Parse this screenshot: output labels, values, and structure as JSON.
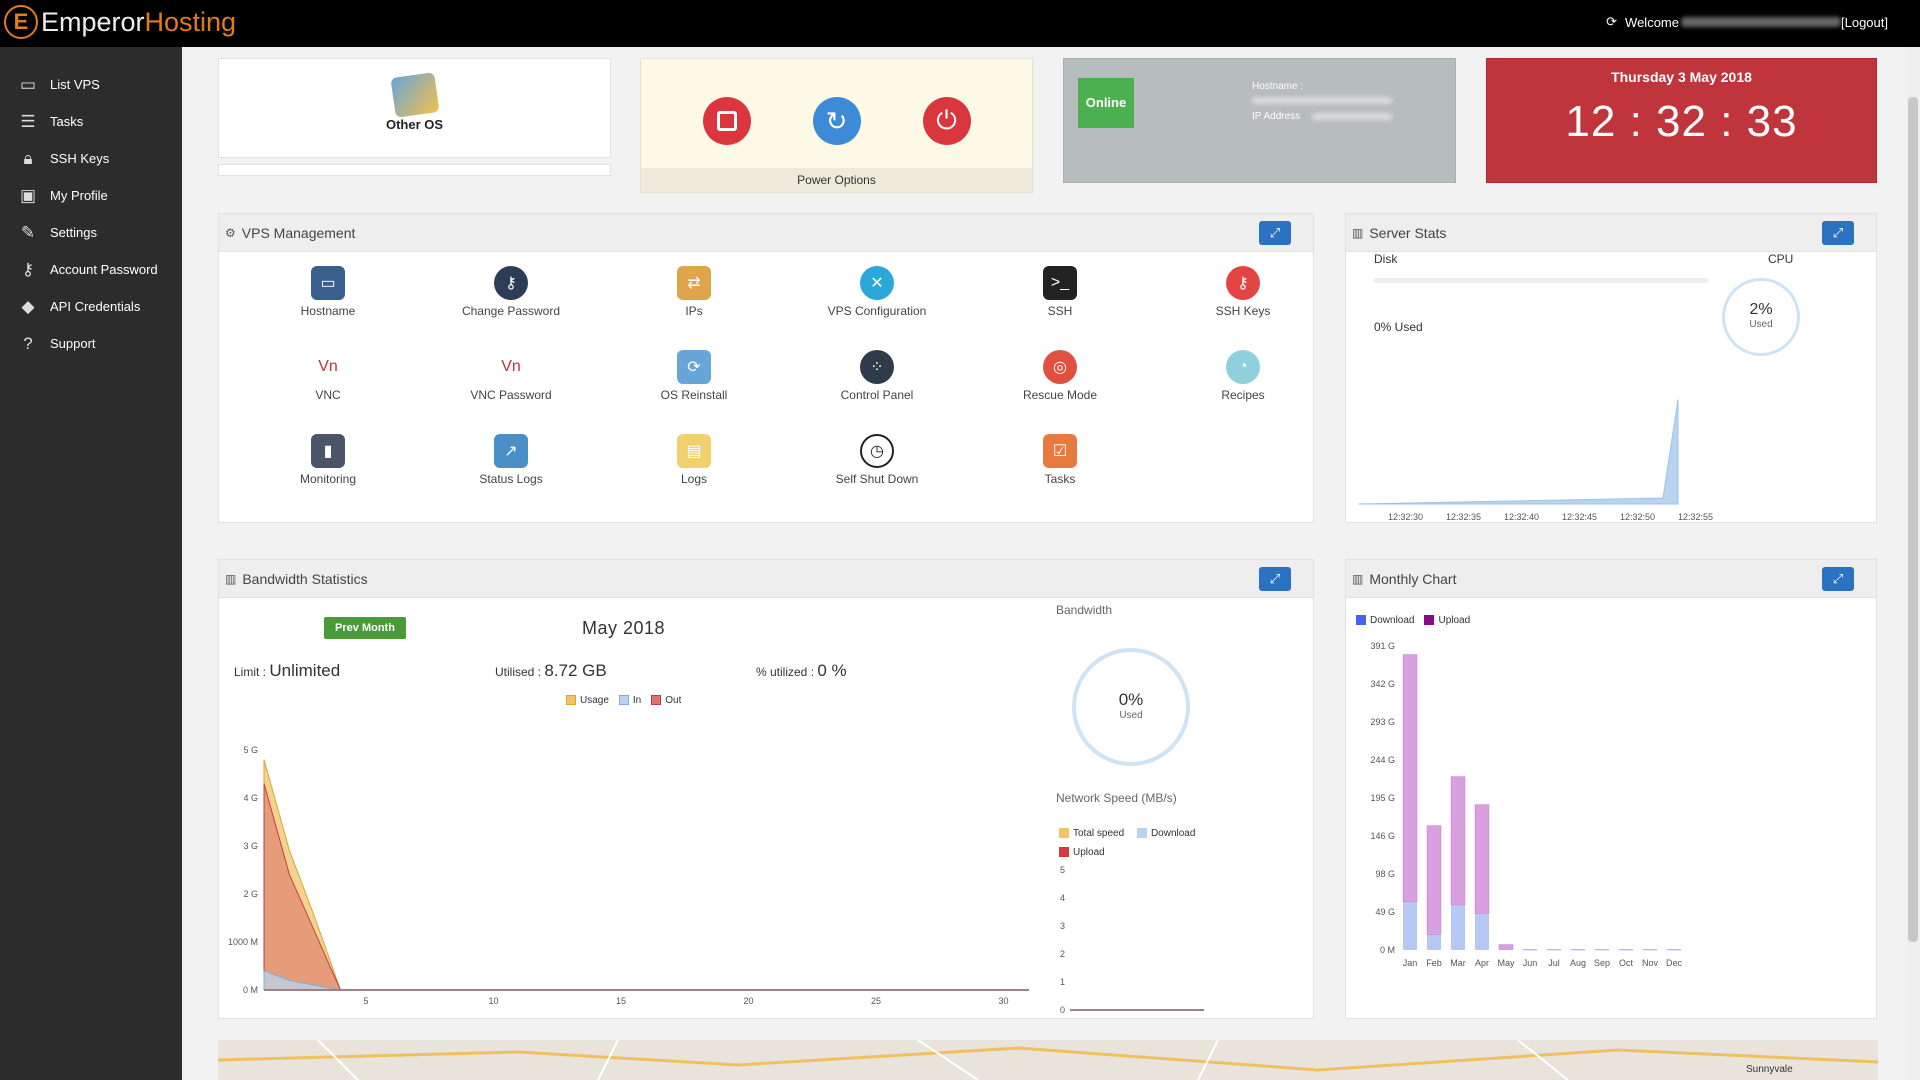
{
  "app": {
    "brand_part1": "Emperor",
    "brand_part2": "Hosting",
    "welcome": "Welcome",
    "logout": "[Logout]"
  },
  "sidebar": {
    "items": [
      {
        "label": "List VPS",
        "icon": "monitor-icon"
      },
      {
        "label": "Tasks",
        "icon": "tasks-icon"
      },
      {
        "label": "SSH Keys",
        "icon": "lock-icon"
      },
      {
        "label": "My Profile",
        "icon": "profile-icon"
      },
      {
        "label": "Settings",
        "icon": "wrench-icon"
      },
      {
        "label": "Account Password",
        "icon": "key-icon"
      },
      {
        "label": "API Credentials",
        "icon": "tags-icon"
      },
      {
        "label": "Support",
        "icon": "question-icon"
      }
    ]
  },
  "os": {
    "label": "Other OS"
  },
  "power": {
    "label": "Power Options"
  },
  "status": {
    "badge": "Online",
    "hostname_label": "Hostname :",
    "ip_label": "IP Address"
  },
  "clock": {
    "date": "Thursday 3 May 2018",
    "time": "12 : 32 : 33"
  },
  "vps": {
    "title": "VPS Management",
    "items": [
      {
        "label": "Hostname",
        "icon": "monitor-icon",
        "color": "#3a5f8f"
      },
      {
        "label": "Change Password",
        "icon": "key-icon",
        "color": "#2e3d55"
      },
      {
        "label": "IPs",
        "icon": "network-icon",
        "color": "#e0a44a"
      },
      {
        "label": "VPS Configuration",
        "icon": "tools-icon",
        "color": "#2aa8d8"
      },
      {
        "label": "SSH",
        "icon": "terminal-icon",
        "color": "#222222"
      },
      {
        "label": "SSH Keys",
        "icon": "ssh-key-icon",
        "color": "#e24444"
      },
      {
        "label": "VNC",
        "icon": "vnc-icon",
        "color": "#ffffff"
      },
      {
        "label": "VNC Password",
        "icon": "vnc-password-icon",
        "color": "#ffffff"
      },
      {
        "label": "OS Reinstall",
        "icon": "os-reinstall-icon",
        "color": "#6aa5d8"
      },
      {
        "label": "Control Panel",
        "icon": "control-panel-icon",
        "color": "#2f3b4a"
      },
      {
        "label": "Rescue Mode",
        "icon": "lifebuoy-icon",
        "color": "#e05040"
      },
      {
        "label": "Recipes",
        "icon": "chef-icon",
        "color": "#8fd0dc"
      },
      {
        "label": "Monitoring",
        "icon": "monitoring-icon",
        "color": "#4a5568"
      },
      {
        "label": "Status Logs",
        "icon": "status-logs-icon",
        "color": "#4a90c8"
      },
      {
        "label": "Logs",
        "icon": "logs-icon",
        "color": "#f2d070"
      },
      {
        "label": "Self Shut Down",
        "icon": "timer-icon",
        "color": "#ffffff"
      },
      {
        "label": "Tasks",
        "icon": "tasks-list-icon",
        "color": "#e87a40"
      }
    ]
  },
  "server_stats": {
    "title": "Server Stats",
    "disk_label": "Disk",
    "disk_used": "0% Used",
    "cpu_label": "CPU",
    "cpu_value": "2%",
    "cpu_sub": "Used",
    "cpu_chart": {
      "type": "area",
      "x": [
        "12:32:30",
        "12:32:35",
        "12:32:40",
        "12:32:45",
        "12:32:50",
        "12:32:55"
      ],
      "peak": 0.95
    }
  },
  "bandwidth": {
    "title": "Bandwidth Statistics",
    "prev_month": "Prev Month",
    "month": "May 2018",
    "limit_label": "Limit :",
    "limit_value": "Unlimited",
    "utilised_label": "Utilised :",
    "utilised_value": "8.72 GB",
    "pct_label": "% utilized :",
    "pct_value": "0 %",
    "legend": [
      "Usage",
      "In",
      "Out"
    ],
    "donut_title": "Bandwidth",
    "donut_value": "0%",
    "donut_sub": "Used",
    "netspeed_title": "Network Speed (MB/s)",
    "netspeed_legend": [
      "Total speed",
      "Download",
      "Upload"
    ]
  },
  "monthly": {
    "title": "Monthly Chart",
    "legend": [
      "Download",
      "Upload"
    ]
  },
  "chart_data": [
    {
      "type": "area",
      "title": "Bandwidth Statistics",
      "y_ticks": [
        "0 M",
        "1000 M",
        "2 G",
        "3 G",
        "4 G",
        "5 G"
      ],
      "x_ticks": [
        "5",
        "10",
        "15",
        "20",
        "25",
        "30"
      ],
      "series": [
        {
          "name": "Usage",
          "x": [
            1,
            2,
            3,
            4,
            31
          ],
          "values": [
            4.8,
            2.9,
            1.5,
            0,
            0
          ]
        },
        {
          "name": "Out",
          "x": [
            1,
            2,
            3,
            4,
            31
          ],
          "values": [
            4.3,
            2.4,
            1.2,
            0,
            0
          ]
        },
        {
          "name": "In",
          "x": [
            1,
            2,
            3,
            4,
            31
          ],
          "values": [
            0.4,
            0.2,
            0.1,
            0,
            0
          ]
        }
      ],
      "ylim": [
        0,
        5
      ]
    },
    {
      "type": "line",
      "title": "Network Speed (MB/s)",
      "y_ticks": [
        "0",
        "1",
        "2",
        "3",
        "4",
        "5"
      ],
      "ylim": [
        0,
        5
      ]
    },
    {
      "type": "bar",
      "title": "Monthly Chart",
      "categories": [
        "Jan",
        "Feb",
        "Mar",
        "Apr",
        "May",
        "Jun",
        "Jul",
        "Aug",
        "Sep",
        "Oct",
        "Nov",
        "Dec"
      ],
      "y_ticks": [
        "0 M",
        "49 G",
        "98 G",
        "146 G",
        "195 G",
        "244 G",
        "293 G",
        "342 G",
        "391 G"
      ],
      "ylim": [
        0,
        391
      ],
      "series": [
        {
          "name": "Download",
          "values": [
            62,
            20,
            58,
            47,
            1,
            0,
            0,
            0,
            0,
            0,
            0,
            0
          ]
        },
        {
          "name": "Upload",
          "values": [
            318,
            140,
            165,
            140,
            6,
            0.5,
            0.5,
            0.5,
            0.5,
            0.5,
            0.5,
            0.5
          ]
        }
      ]
    }
  ],
  "map": {
    "label": "Sunnyvale"
  }
}
